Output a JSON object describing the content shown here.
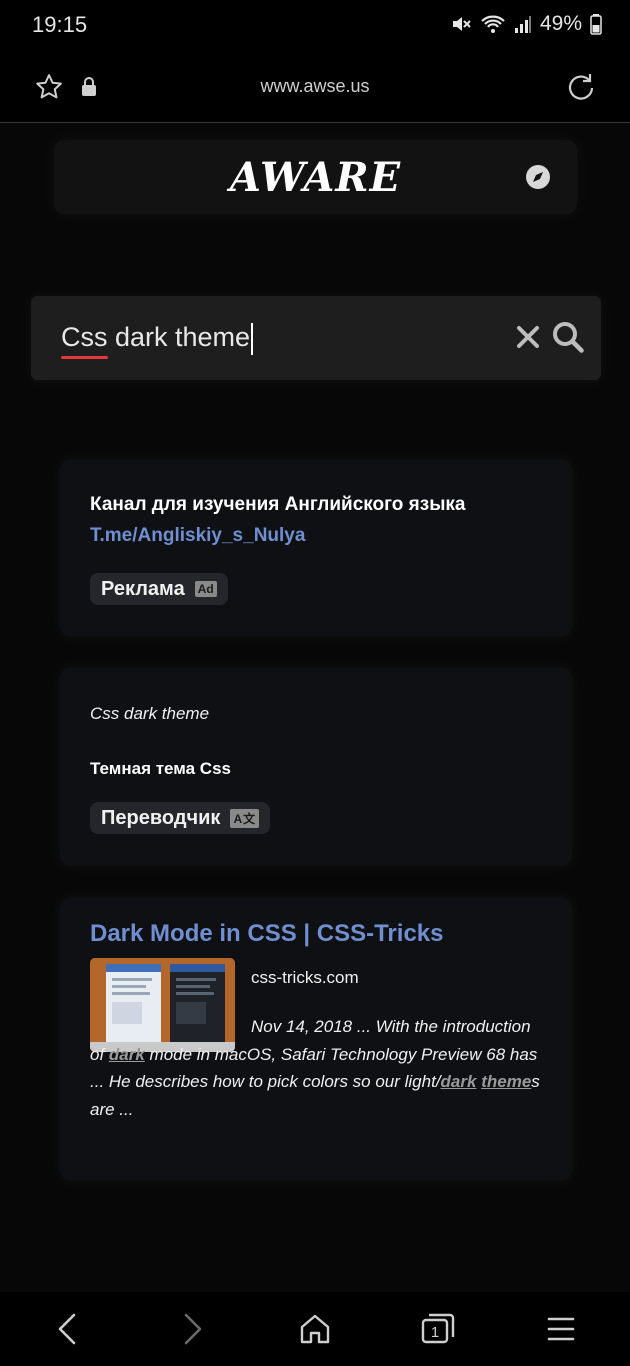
{
  "status_bar": {
    "time": "19:15",
    "battery": "49%",
    "icons": [
      "mute-icon",
      "wifi-icon",
      "signal-icon",
      "battery-icon"
    ]
  },
  "url_bar": {
    "url": "www.awse.us",
    "icons": [
      "star-icon",
      "lock-icon",
      "reload-icon"
    ]
  },
  "site": {
    "logo": "AWARE",
    "icons": [
      "compass-icon"
    ]
  },
  "search": {
    "query_misspelled": "Css",
    "query_rest": " dark theme",
    "icons": [
      "clear-icon",
      "search-icon"
    ]
  },
  "ad": {
    "title": "Канал для изучения Английского языка",
    "link": "T.me/Angliskiy_s_Nulya",
    "chip_label": "Реклама",
    "badge": "Ad"
  },
  "translator": {
    "source": "Css dark theme",
    "result": "Темная тема Css",
    "chip_label": "Переводчик",
    "badge": "A文"
  },
  "result": {
    "title": "Dark Mode in CSS | CSS-Tricks",
    "domain": "css-tricks.com",
    "snippet_1": "Nov 14, 2018 ... With the introduction of ",
    "hl_1": "dark",
    "snippet_2": " mode in macOS, Safari Technology Preview 68 has ... He describes how to pick colors so our light/",
    "hl_2": "dark",
    "snippet_3": " ",
    "hl_3": "theme",
    "snippet_4": "s are ..."
  },
  "bottom_nav": {
    "tab_count": "1",
    "icons": [
      "back-icon",
      "forward-icon",
      "home-icon",
      "tabs-icon",
      "menu-icon"
    ]
  },
  "colors": {
    "link": "#6f8fd0",
    "background": "#070707",
    "card": "#0f1014",
    "spell_error": "#e23b3b"
  }
}
